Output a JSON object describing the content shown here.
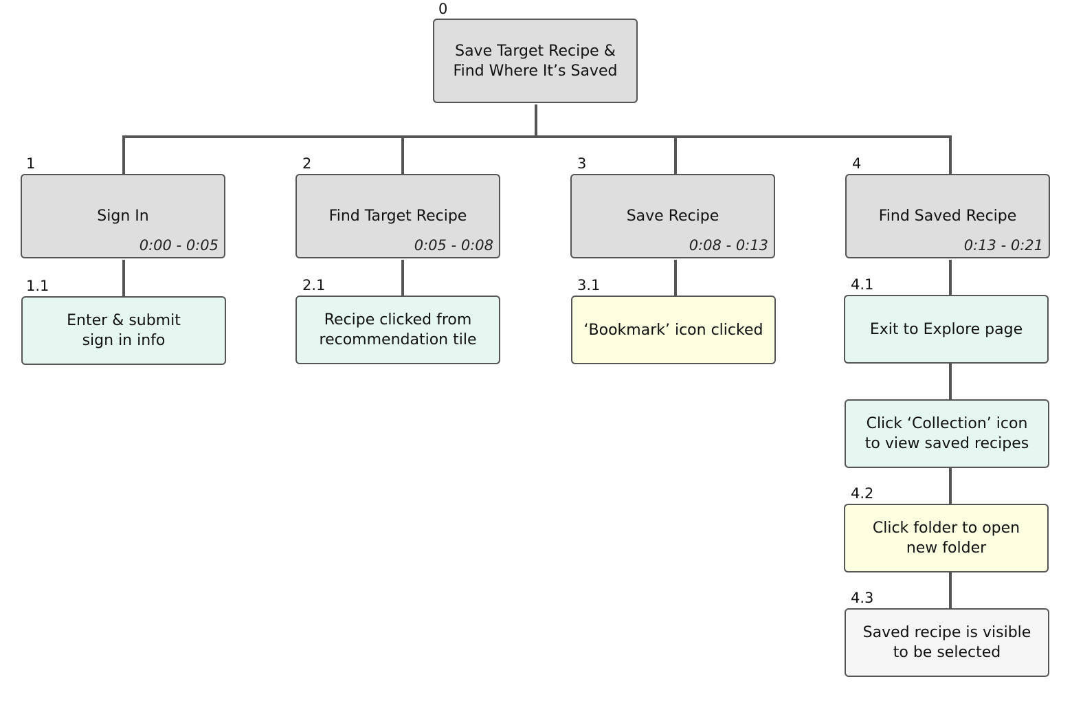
{
  "colors": {
    "task": "#dedede",
    "action": "#e6f6f1",
    "highlight": "#fefee0",
    "end": "#f5f5f5",
    "line": "#555555"
  },
  "root": {
    "num": "0",
    "text": "Save Target Recipe &\nFind Where It’s Saved"
  },
  "tasks": [
    {
      "num": "1",
      "text": "Sign In",
      "time": "0:00 - 0:05"
    },
    {
      "num": "2",
      "text": "Find Target Recipe",
      "time": "0:05 - 0:08"
    },
    {
      "num": "3",
      "text": "Save Recipe",
      "time": "0:08 - 0:13"
    },
    {
      "num": "4",
      "text": "Find Saved Recipe",
      "time": "0:13 - 0:21"
    }
  ],
  "subtasks": [
    {
      "num": "1.1",
      "text": "Enter & submit\nsign in info"
    },
    {
      "num": "2.1",
      "text": "Recipe clicked from\nrecommendation tile"
    },
    {
      "num": "3.1",
      "text": "‘Bookmark’ icon clicked"
    },
    {
      "num": "4.1",
      "text": "Exit to Explore page"
    },
    {
      "num": "",
      "text": "Click ‘Collection’ icon\nto view saved recipes"
    },
    {
      "num": "4.2",
      "text": "Click folder to open\nnew folder"
    },
    {
      "num": "4.3",
      "text": "Saved recipe is visible\nto be selected"
    }
  ]
}
